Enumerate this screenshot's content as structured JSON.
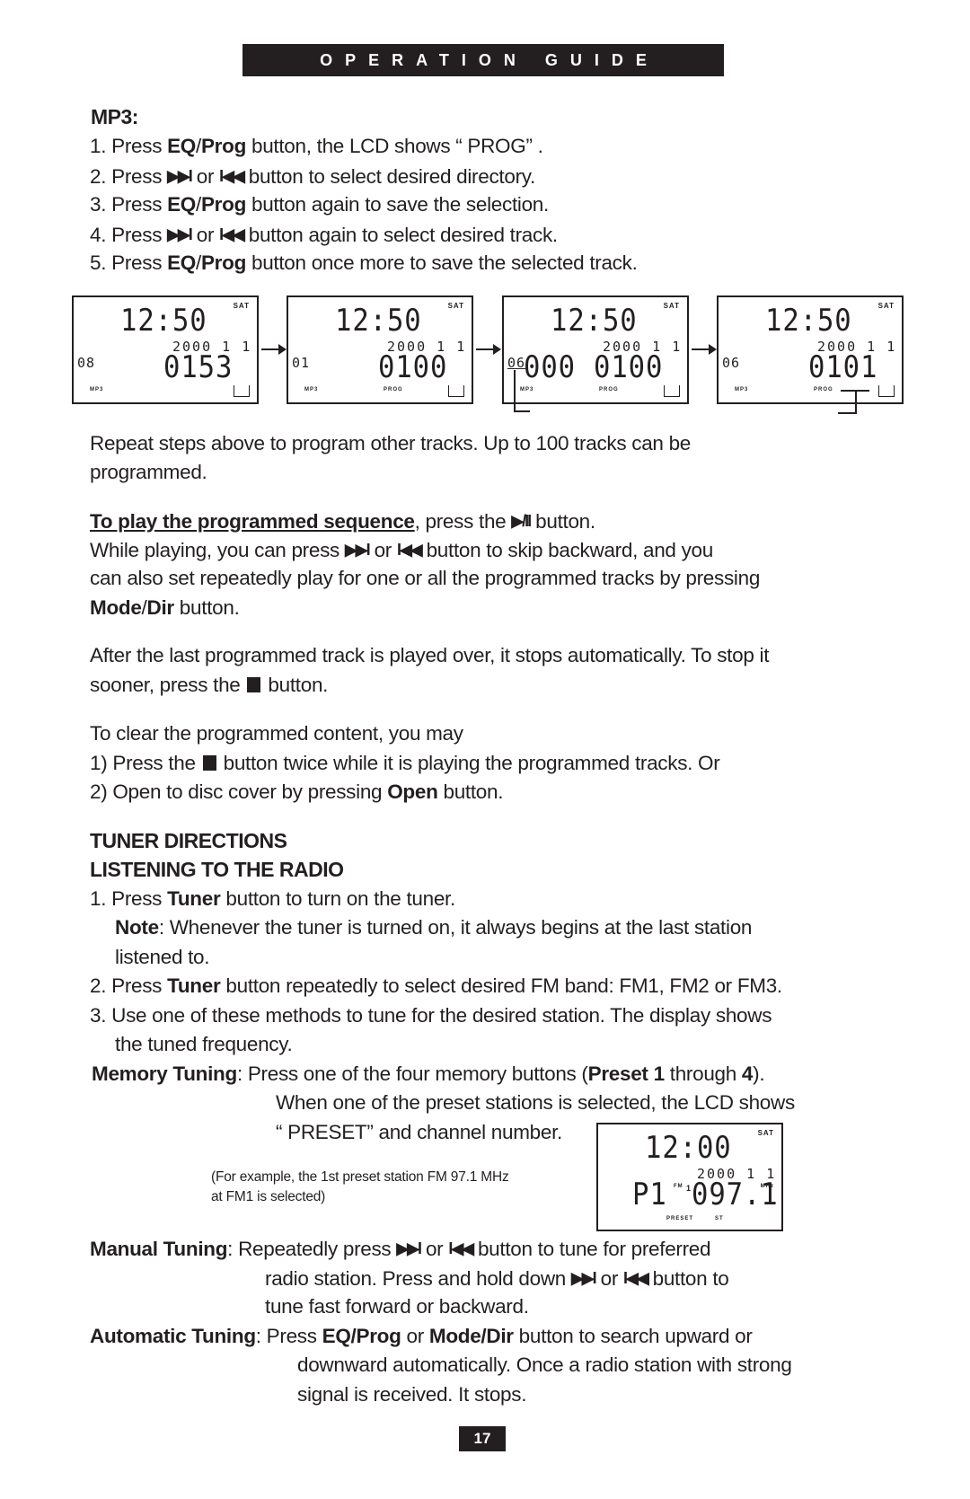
{
  "header": {
    "title": "OPERATION GUIDE"
  },
  "mp3": {
    "heading": "MP3:",
    "steps": [
      {
        "num": "1. ",
        "pre": "Press ",
        "bold1": "EQ",
        "sep": "/",
        "bold2": "Prog",
        "post": " button, the LCD shows “ PROG” ."
      },
      {
        "num": "2. ",
        "pre": "Press ",
        "sym1": "next-track",
        "mid": " or ",
        "sym2": "prev-track",
        "post": " button to select desired directory."
      },
      {
        "num": "3. ",
        "pre": "Press ",
        "bold1": "EQ",
        "sep": "/",
        "bold2": "Prog",
        "post": " button again to save the selection."
      },
      {
        "num": "4. ",
        "pre": "Press ",
        "sym1": "next-track",
        "mid": " or ",
        "sym2": "prev-track",
        "post": " button again to select desired track."
      },
      {
        "num": "5. ",
        "pre": "Press ",
        "bold1": "EQ",
        "sep": "/",
        "bold2": "Prog",
        "post": " button once more to save the selected track."
      }
    ],
    "symbols": {
      "next": "▶▶I",
      "prev": "I◀◀",
      "play_pause": "▶/II"
    },
    "lcd_panels": [
      {
        "day": "SAT",
        "clock": "12:50",
        "date": "2000  1 1",
        "dir": "08",
        "left_big": "",
        "main": "0153",
        "tag_left": "MP3",
        "tag_mid": ""
      },
      {
        "day": "SAT",
        "clock": "12:50",
        "date": "2000  1 1",
        "dir": "01",
        "left_big": "",
        "main": "0100",
        "tag_left": "MP3",
        "tag_mid": "PROG"
      },
      {
        "day": "SAT",
        "clock": "12:50",
        "date": "2000  1 1",
        "dir": "06",
        "left_big": "000",
        "main": "0100",
        "tag_left": "MP3",
        "tag_mid": "PROG"
      },
      {
        "day": "SAT",
        "clock": "12:50",
        "date": "2000  1 1",
        "dir": "06",
        "left_big": "",
        "main": "0101",
        "tag_left": "MP3",
        "tag_mid": "PROG"
      }
    ]
  },
  "body": {
    "repeat_line1": "Repeat steps above to program other tracks. Up to 100 tracks can be",
    "repeat_line2": "programmed.",
    "play_heading": "To play the programmed sequence",
    "play_post": ", press the ",
    "play_end": " button.",
    "while_pre": "While playing, you can press ",
    "while_or": " or ",
    "while_post": " button to skip backward, and you",
    "while_line2": "can also set repeatedly play for one or all the programmed tracks by pressing",
    "mode_bold1": "Mode",
    "mode_sep": "/",
    "mode_bold2": "Dir",
    "mode_post": " button.",
    "after_line1": "After the last programmed track is played over, it stops automatically. To stop it",
    "after_pre": "sooner, press the ",
    "after_post": " button.",
    "clear_intro": "To clear the programmed content, you may",
    "clear1_pre": "1) Press the ",
    "clear1_post": " button twice while it is playing the programmed tracks. Or",
    "clear2_pre": "2) Open to disc cover by pressing ",
    "clear2_bold": "Open",
    "clear2_post": " button."
  },
  "tuner": {
    "heading1": "TUNER DIRECTIONS",
    "heading2": "LISTENING TO THE RADIO",
    "s1_pre": "1. Press ",
    "s1_bold": "Tuner",
    "s1_post": " button to turn on the tuner.",
    "note_bold": "Note",
    "note_text": ": Whenever the tuner is turned on, it always begins at the last station",
    "note_line2": "listened to.",
    "s2_pre": "2. Press ",
    "s2_bold": "Tuner",
    "s2_post": " button repeatedly to select desired FM band: FM1, FM2 or FM3.",
    "s3_line1": "3. Use one of these methods to tune for the desired station. The display shows",
    "s3_line2": "the tuned frequency.",
    "memory_label": "Memory Tuning",
    "memory_l1_pre": ": Press one of the four memory buttons (",
    "memory_preset": "Preset 1",
    "memory_through": " through ",
    "memory_4": "4",
    "memory_close": ").",
    "memory_l2": "When one of the preset stations is selected, the LCD shows",
    "memory_l3": "“ PRESET”  and channel number.",
    "example_l1": "(For example, the 1st preset station FM 97.1 MHz",
    "example_l2": "at FM1 is selected)",
    "radio_lcd": {
      "day": "SAT",
      "clock": "12:00",
      "date": "2000  1 1",
      "preset": "P1",
      "band": "FM",
      "band_num": "1",
      "freq": "097.1",
      "unit": "MHz",
      "tag_left": "PRESET",
      "tag_mid": "ST"
    },
    "manual_label": "Manual Tuning",
    "manual_l1_pre": ": Repeatedly press ",
    "manual_l1_or": "  or ",
    "manual_l1_post": " button to tune for preferred",
    "manual_l2_pre": "radio station. Press and hold down ",
    "manual_l2_or": "  or ",
    "manual_l2_post": " button to",
    "manual_l3": "tune fast forward or backward.",
    "auto_label": "Automatic Tuning",
    "auto_l1_pre": ": Press ",
    "auto_b1": "EQ/Prog",
    "auto_or": " or ",
    "auto_b2": "Mode/Dir",
    "auto_l1_post": " button to search upward or",
    "auto_l2": "downward automatically. Once a radio station with strong",
    "auto_l3": "signal is received. It stops."
  },
  "footer": {
    "page_number": "17"
  }
}
